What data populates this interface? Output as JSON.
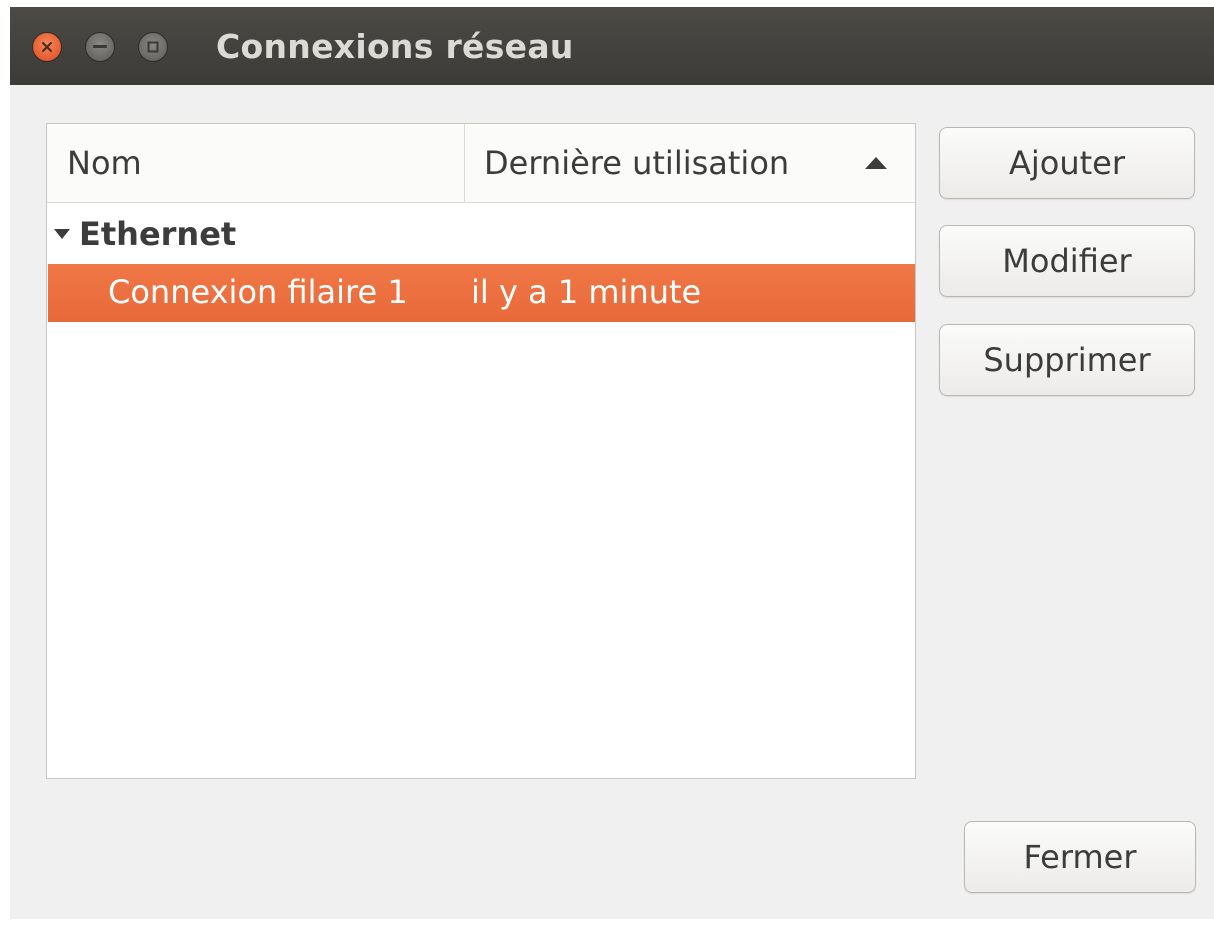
{
  "window": {
    "title": "Connexions réseau",
    "controls": [
      "close-icon",
      "minimize-icon",
      "maximize-icon"
    ]
  },
  "list": {
    "columns": [
      {
        "label": "Nom"
      },
      {
        "label": "Dernière utilisation",
        "sort": "ascending",
        "sort_icon": "sort-up-icon"
      }
    ],
    "groups": [
      {
        "name": "Ethernet",
        "expanded": true,
        "connections": [
          {
            "name": "Connexion filaire 1",
            "last_used": "il y a 1 minute",
            "selected": true
          }
        ]
      }
    ]
  },
  "buttons": {
    "add": "Ajouter",
    "edit": "Modifier",
    "delete": "Supprimer",
    "close": "Fermer"
  },
  "colors": {
    "titlebar": "#3f3e39",
    "selection": "#ec6f3f",
    "window_bg": "#f0f0f0",
    "close_button": "#e5572b"
  }
}
